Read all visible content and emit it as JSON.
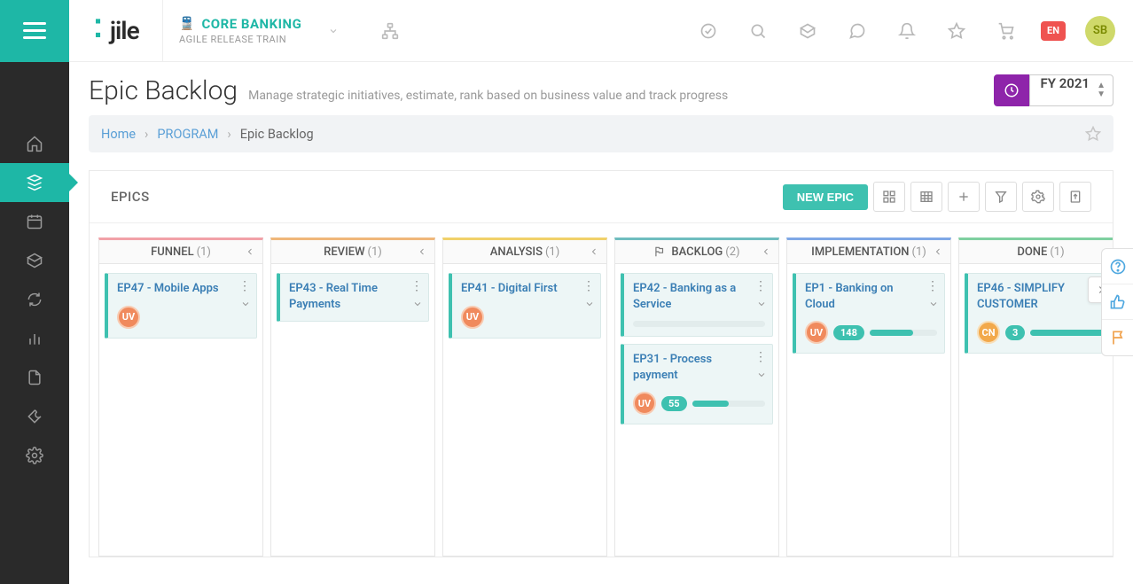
{
  "header": {
    "project_title": "CORE BANKING",
    "project_subtitle": "AGILE RELEASE TRAIN",
    "lang_badge": "EN",
    "user_initials": "SB"
  },
  "page": {
    "title": "Epic Backlog",
    "subtitle": "Manage strategic initiatives, estimate, rank based on business value and track progress",
    "period_label": "FY 2021"
  },
  "breadcrumb": {
    "home": "Home",
    "program": "PROGRAM",
    "current": "Epic Backlog"
  },
  "board": {
    "section_title": "EPICS",
    "new_epic_label": "NEW EPIC"
  },
  "lanes": [
    {
      "accent": "pink",
      "title": "FUNNEL",
      "count": "(1)",
      "flag": false,
      "cards": [
        {
          "title": "EP47 - Mobile Apps",
          "avatar": "UV",
          "avatar_class": "av-orange"
        }
      ]
    },
    {
      "accent": "orange",
      "title": "REVIEW",
      "count": "(1)",
      "flag": false,
      "cards": [
        {
          "title": "EP43 - Real Time Payments"
        }
      ]
    },
    {
      "accent": "yellow",
      "title": "ANALYSIS",
      "count": "(1)",
      "flag": false,
      "cards": [
        {
          "title": "EP41 - Digital First",
          "avatar": "UV",
          "avatar_class": "av-orange"
        }
      ]
    },
    {
      "accent": "blue",
      "title": "BACKLOG",
      "count": "(2)",
      "flag": true,
      "cards": [
        {
          "title": "EP42 - Banking as a Service",
          "progress": 0
        },
        {
          "title": "EP31 - Process payment",
          "avatar": "UV",
          "avatar_class": "av-orange",
          "pill": "55",
          "progress": 50
        }
      ]
    },
    {
      "accent": "indigo",
      "title": "IMPLEMENTATION",
      "count": "(1)",
      "flag": false,
      "cards": [
        {
          "title": "EP1 - Banking on Cloud",
          "avatar": "UV",
          "avatar_class": "av-orange",
          "pill": "148",
          "progress": 65
        }
      ]
    },
    {
      "accent": "green",
      "title": "DONE",
      "count": "(1)",
      "flag": false,
      "cards": [
        {
          "title": "EP46 - SIMPLIFY CUSTOMER",
          "avatar": "CN",
          "avatar_class": "av-amber",
          "pill": "3",
          "progress": 100
        }
      ]
    }
  ]
}
